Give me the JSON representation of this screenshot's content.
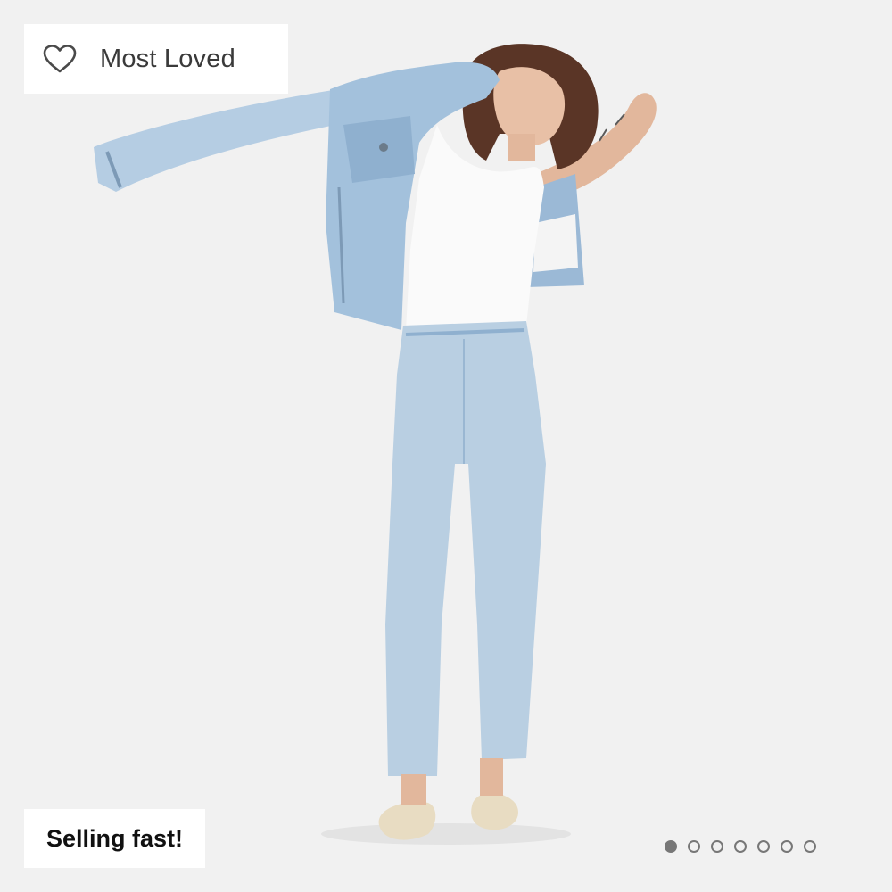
{
  "badges": {
    "top": {
      "label": "Most Loved",
      "icon": "heart-outline-icon"
    },
    "bottom": {
      "label": "Selling fast!"
    }
  },
  "carousel": {
    "total": 7,
    "active_index": 0
  },
  "colors": {
    "background": "#f1f1f1",
    "badge_bg": "#ffffff",
    "dot": "#777777",
    "denim_light": "#b9cfe2",
    "denim_mid": "#8fb0cf",
    "tank": "#fafafa",
    "hair": "#5a3526",
    "skin": "#e2b79c",
    "shoes": "#e8dcc2"
  }
}
